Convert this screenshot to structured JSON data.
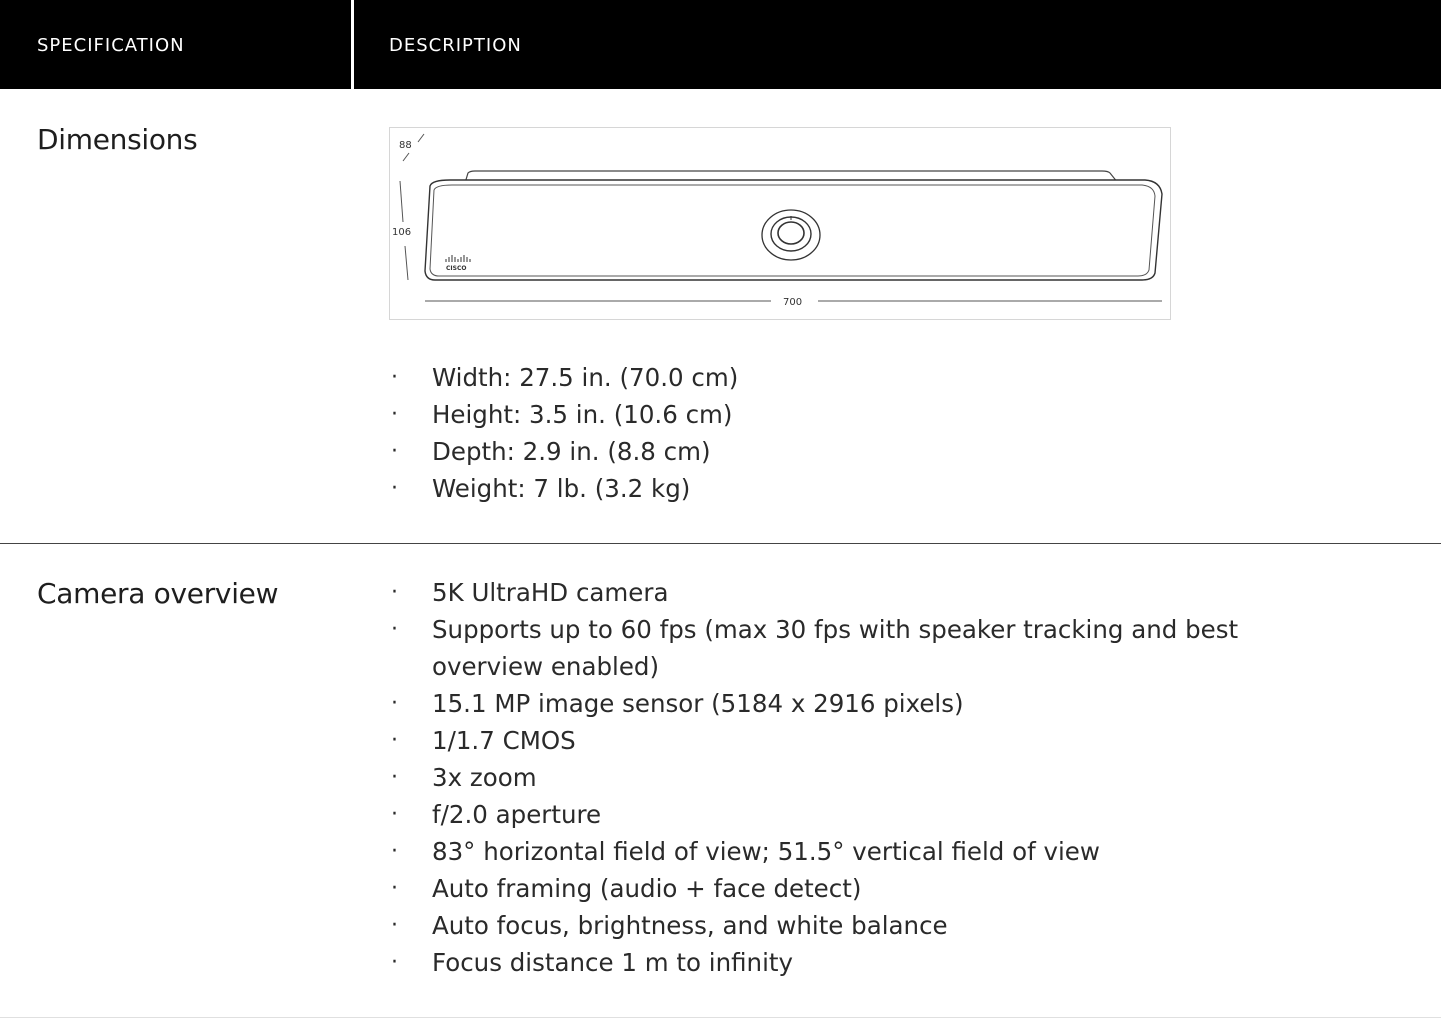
{
  "header": {
    "spec_col": "SPECIFICATION",
    "desc_col": "DESCRIPTION"
  },
  "sections": [
    {
      "name": "Dimensions",
      "figure": {
        "depth_label": "88",
        "height_label": "106",
        "width_label": "700",
        "logo_text": "CISCO"
      },
      "items": [
        "Width: 27.5 in. (70.0 cm)",
        "Height: 3.5 in. (10.6 cm)",
        "Depth: 2.9 in. (8.8 cm)",
        "Weight: 7 lb. (3.2 kg)"
      ]
    },
    {
      "name": "Camera overview",
      "items": [
        "5K UltraHD camera",
        "Supports up to 60 fps (max 30 fps with speaker tracking and best overview enabled)",
        "15.1 MP image sensor (5184 x 2916 pixels)",
        "1/1.7 CMOS",
        "3x zoom",
        "f/2.0 aperture",
        "83° horizontal field of view; 51.5° vertical field of view",
        "Auto framing (audio + face detect)",
        "Auto focus, brightness, and white balance",
        "Focus distance 1 m to infinity"
      ]
    }
  ],
  "bullet_char": "·",
  "colors": {
    "header_bg": "#000000",
    "header_text": "#ffffff",
    "body_text": "#1e1e1e"
  }
}
